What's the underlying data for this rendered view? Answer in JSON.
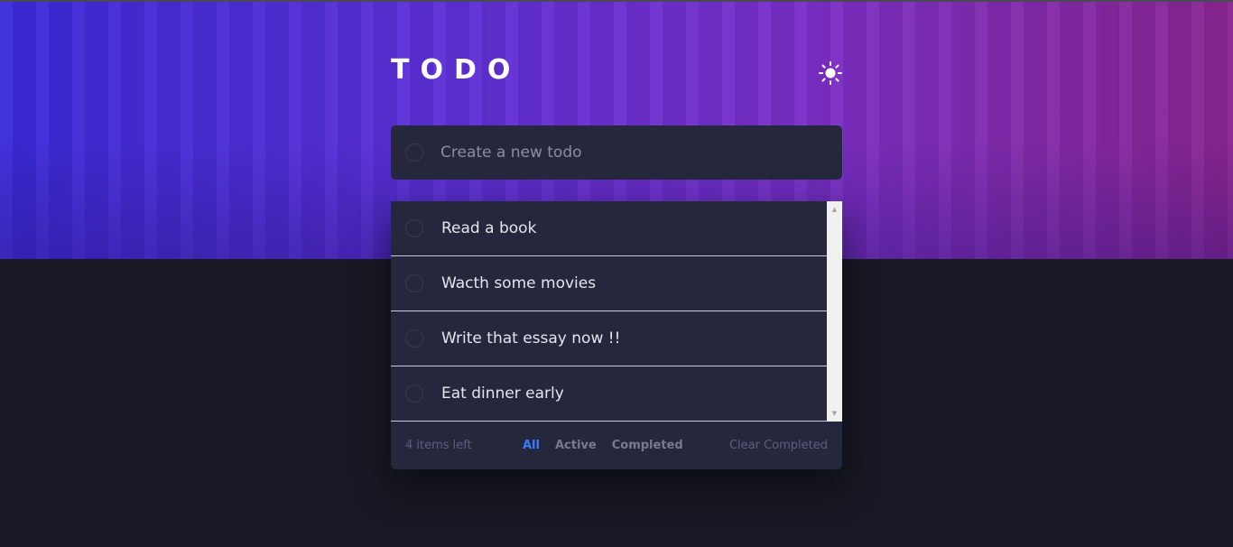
{
  "header": {
    "title": "TODO",
    "theme_icon": "sun-icon"
  },
  "new_todo": {
    "placeholder": "Create a new todo",
    "value": ""
  },
  "todos": [
    {
      "text": "Read a book",
      "completed": false
    },
    {
      "text": "Wacth some movies",
      "completed": false
    },
    {
      "text": "Write that essay now !!",
      "completed": false
    },
    {
      "text": "Eat dinner early",
      "completed": false
    }
  ],
  "footer": {
    "items_left": "4 items left",
    "filters": [
      "All",
      "Active",
      "Completed"
    ],
    "active_filter": "All",
    "clear_label": "Clear Completed"
  },
  "colors": {
    "accent": "#3a7cfd",
    "card": "#25273c",
    "background": "#181824",
    "gradient_start": "#3a2ad8",
    "gradient_end": "#8a2590"
  }
}
